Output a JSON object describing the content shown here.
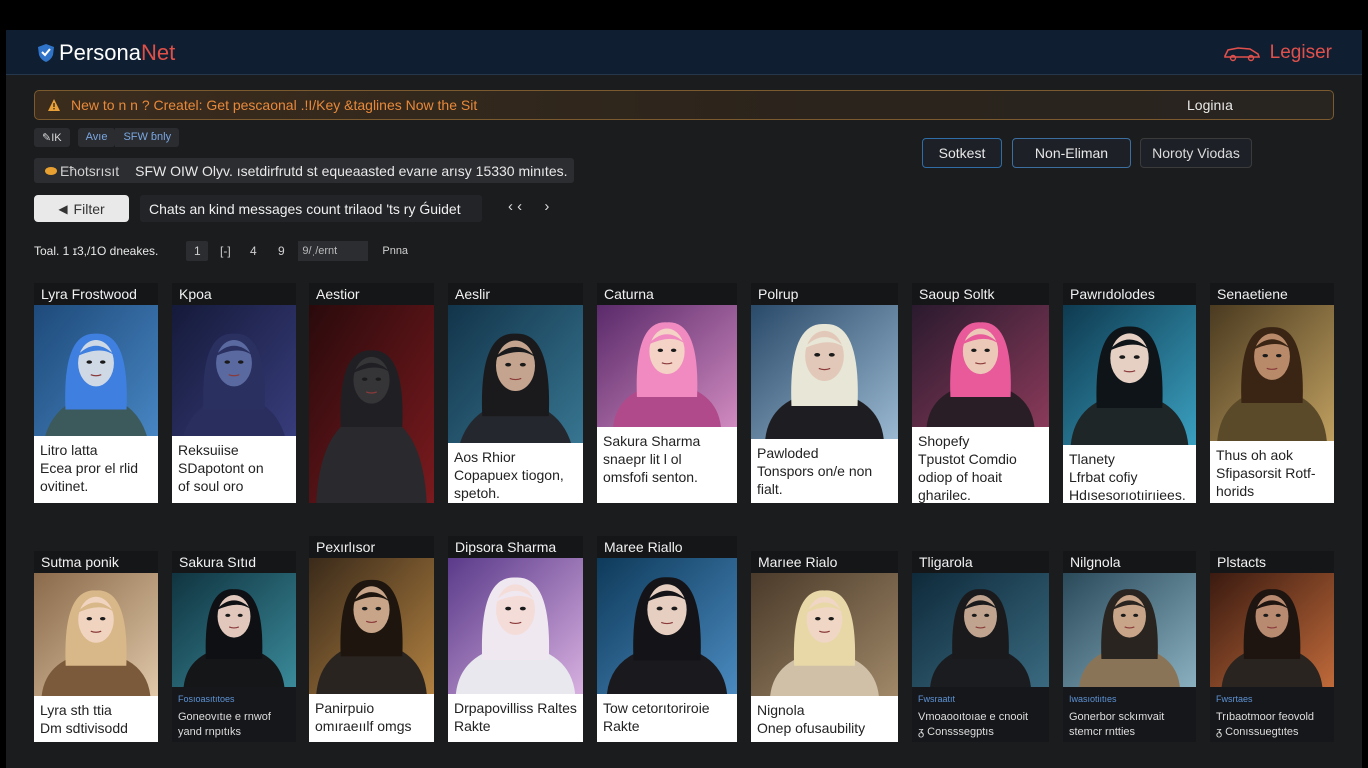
{
  "app": {
    "logo_part1": "Persona",
    "logo_part2": "Net",
    "login_label": "Legiser"
  },
  "banner": {
    "text": "New to n n ? Createl: Get pescaonal .!I/Key &taglines Now the Sit",
    "login": "Loginıa"
  },
  "chips": [
    "✎IK",
    "Avıe",
    "SFW ɓnly"
  ],
  "sfw_bar": {
    "label": "Eħotsrısıt",
    "text": "SFW OIW Olyv. ısetdirfrutd st equeaasted evarıe arısy 15330 minıtes."
  },
  "sort_buttons": [
    "Sotkest",
    "Non-Eliman",
    "Noroty Viodas"
  ],
  "filter_label": "Filter",
  "chats_text": "Chats an kind messages count  trilaod 'ts ry Ǵuidet",
  "pager_arrows": [
    "‹ ‹",
    "›"
  ],
  "count_text": "Toal.  1  ɪ3,/1O dneakes.",
  "pager": {
    "pages": [
      "1",
      "[-]",
      "4",
      "9"
    ],
    "select": "9/ˌ/ernt",
    "next": "Pnna"
  },
  "cards": [
    {
      "name": "Lyra Frostwood",
      "desc": [
        "Litro latta",
        "Ecea pror el rlid",
        "ovitinet."
      ]
    },
    {
      "name": "Kpoa",
      "desc": [
        "Reksuiise",
        "SDapotont on",
        "of soul oro"
      ]
    },
    {
      "name": "Aestior",
      "desc": []
    },
    {
      "name": "Aeslir",
      "desc": [
        "Aos Rhior",
        "Copapuex tiogon,",
        "spetoh."
      ]
    },
    {
      "name": "Caturna",
      "desc": [
        "Sakura Sharma",
        "snaepr lit l ol",
        "omsfofi senton."
      ]
    },
    {
      "name": "Polrup",
      "desc": [
        "Pawloded",
        "Tonspors on/e non",
        "fialt."
      ]
    },
    {
      "name": "Saoup Soltk",
      "desc": [
        "Shopefy",
        "Tpustot Comdio",
        "odiop of hoait",
        "gharilec."
      ]
    },
    {
      "name": "Pawrıdolodes",
      "desc": [
        "Tlanety",
        "Lfrbat cofiy",
        "Hdısesorıotıirıiees."
      ]
    },
    {
      "name": "Senaetiene",
      "desc": [
        "Thus oh aok",
        "Sfipasorsit Rotf-",
        "horids"
      ]
    },
    {
      "name": "Sutma ponik",
      "desc": [
        "Lyra sth ttia",
        "Dm sdtivisodd"
      ]
    },
    {
      "name": "Sakura Sıtıd",
      "tag": "Fosıoasıtıtoes",
      "desc": [
        "Goneovıtıe e rnwof",
        "yand rnpıtıks"
      ]
    },
    {
      "name": "Pexırlısor",
      "desc": [
        "Panirpuio",
        "omıraeıılf omgs"
      ]
    },
    {
      "name": "Dipsora Sharma",
      "desc": [
        "Drpapovilliss Raltes",
        "Rakte"
      ]
    },
    {
      "name": "Maree Riallo",
      "desc": [
        "Tow cetorıtoriroie",
        "Rakte"
      ]
    },
    {
      "name": "Marıee Rialo",
      "desc": [
        "Nignola",
        "Onep ofusaubility"
      ]
    },
    {
      "name": "Tligarola",
      "tag": "Fwsraatıt",
      "desc": [
        "Vmoaooıtoıae e cnooit",
        "ᵹ Consssegptıs"
      ]
    },
    {
      "name": "Nilgnola",
      "tag": "Iwasıotiıtıes",
      "desc": [
        "Gonerbor sckımvait",
        "stemcr rntties"
      ]
    },
    {
      "name": "Plstacts",
      "tag": "Fwsrtaes",
      "desc": [
        "Trıbaotmoor feovold",
        "ᵹ Conıssuegtıtes"
      ]
    }
  ],
  "colors": {
    "brand_red": "#e05048",
    "banner_orange": "#e8893a",
    "link_blue": "#5d93d6",
    "topbar": "#0f1e30"
  }
}
